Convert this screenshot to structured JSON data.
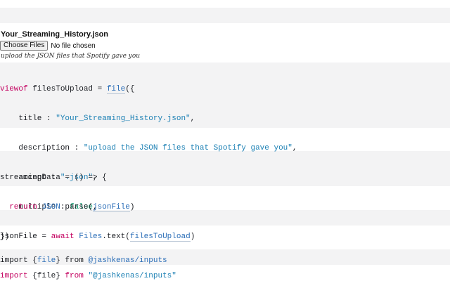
{
  "form": {
    "title": "Your_Streaming_History.json",
    "button_label": "Choose Files",
    "no_file_text": "No file chosen",
    "description": "upload the JSON files that Spotify gave you"
  },
  "cell1": {
    "l1": {
      "kw": "viewof",
      "a": " filesToUpload = ",
      "ref": "file",
      "b": "({"
    },
    "l2": {
      "a": "    title : ",
      "str": "\"Your_Streaming_History.json\"",
      "b": ","
    },
    "l3": {
      "a": "    description : ",
      "str": "\"upload the JSON files that Spotify gave you\"",
      "b": ","
    },
    "l4": {
      "a": "    accept : ",
      "str": "\".json\"",
      "b": ","
    },
    "l5": {
      "a": "    multiple : ",
      "lit": "false",
      "b": ","
    },
    "l6": {
      "a": "})"
    }
  },
  "cell2": {
    "l1": {
      "a": "streamingData = () => {"
    },
    "l2": {
      "a": "  ",
      "kw": "return",
      "b": " ",
      "obj": "JSON",
      "c": ".parse(",
      "ref": "jsonFile",
      "d": ")"
    },
    "l3": {
      "a": "}"
    }
  },
  "cell3": {
    "l1": {
      "a": "jsonFile = ",
      "kw": "await",
      "b": " ",
      "obj": "Files",
      "c": ".text(",
      "ref": "filesToUpload",
      "d": ")"
    }
  },
  "cell4": {
    "l1": {
      "a": "import {",
      "name": "file",
      "b": "} from ",
      "src": "@jashkenas/inputs"
    }
  },
  "cell5": {
    "l1": {
      "kw1": "import",
      "a": " {file} ",
      "kw2": "from",
      "b": " ",
      "str": "\"@jashkenas/inputs\""
    }
  }
}
